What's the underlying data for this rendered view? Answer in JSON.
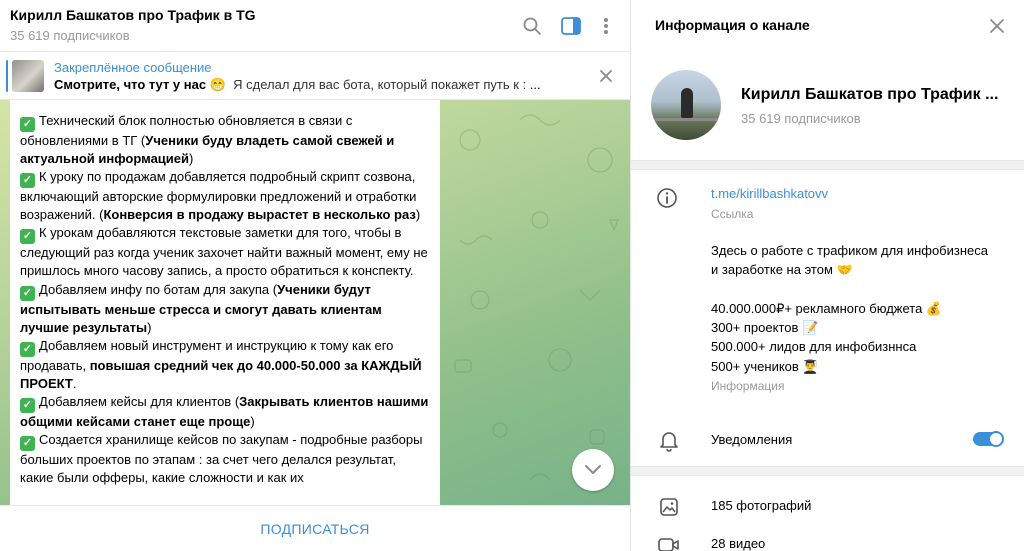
{
  "chat": {
    "title": "Кирилл Башкатов про Трафик в TG",
    "subscribers": "35 619 подписчиков",
    "icons": [
      "search-icon",
      "sidebar-toggle-icon",
      "more-vertical-icon"
    ]
  },
  "pinned": {
    "label": "Закреплённое сообщение",
    "text_bold": "Смотрите, что тут у нас",
    "emoji": "😁",
    "text_rest": "Я сделал для вас бота, который покажет путь к :"
  },
  "message": {
    "paragraphs": [
      {
        "plain": "Технический блок полностью обновляется в связи  с обновлениями в ТГ (",
        "bold": "Ученики буду владеть самой свежей и актуальной информацией",
        "tail": ")"
      },
      {
        "plain": "К уроку по продажам добавляется подробный скрипт созвона, включающий авторские формулировки предложений и отработки возражений. (",
        "bold": "Конверсия в продажу вырастет в несколько раз",
        "tail": ")"
      },
      {
        "plain": "К урокам добавляются текстовые заметки для того, чтобы в следующий  раз когда ученик захочет найти важный момент, ему не пришлось много часову запись, а просто обратиться к конспекту.",
        "bold": "",
        "tail": ""
      },
      {
        "plain": "Добавляем инфу по ботам для закупа (",
        "bold": "Ученики будут испытывать меньше стресса и смогут давать клиентам лучшие результаты",
        "tail": ")"
      },
      {
        "plain": "Добавляем новый инструмент и инструкцию к тому как его продавать, ",
        "bold": "повышая средний чек до 40.000-50.000 за КАЖДЫЙ ПРОЕКТ",
        "tail": "."
      },
      {
        "plain": "Добавляем кейсы для клиентов (",
        "bold": "Закрывать клиентов нашими общими кейсами станет еще проще",
        "tail": ")"
      },
      {
        "plain": "Создается хранилище кейсов по закупам - подробные разборы больших проектов по этапам : за счет чего делался результат, какие были офферы, какие сложности и как их",
        "bold": "",
        "tail": ""
      }
    ]
  },
  "footer": {
    "subscribe_label": "ПОДПИСАТЬСЯ"
  },
  "info": {
    "title": "Информация о канале",
    "name": "Кирилл Башкатов про Трафик ...",
    "subscribers": "35 619 подписчиков",
    "link": "t.me/kirillbashkatovv",
    "link_caption": "Ссылка",
    "about_lines": [
      "Здесь о работе с трафиком для инфобизнеса",
      "и заработке на этом 🤝",
      "",
      "40.000.000₽+ рекламного бюджета 💰",
      "300+ проектов 📝",
      "500.000+ лидов для инфобизннса",
      "500+ учеников 👨‍🎓"
    ],
    "about_caption": "Информация",
    "notifications_label": "Уведомления",
    "notifications_on": true,
    "photos": "185 фотографий",
    "videos": "28 видео"
  },
  "colors": {
    "accent": "#3a8fd9",
    "check": "#3fb34f",
    "muted": "#999999"
  }
}
